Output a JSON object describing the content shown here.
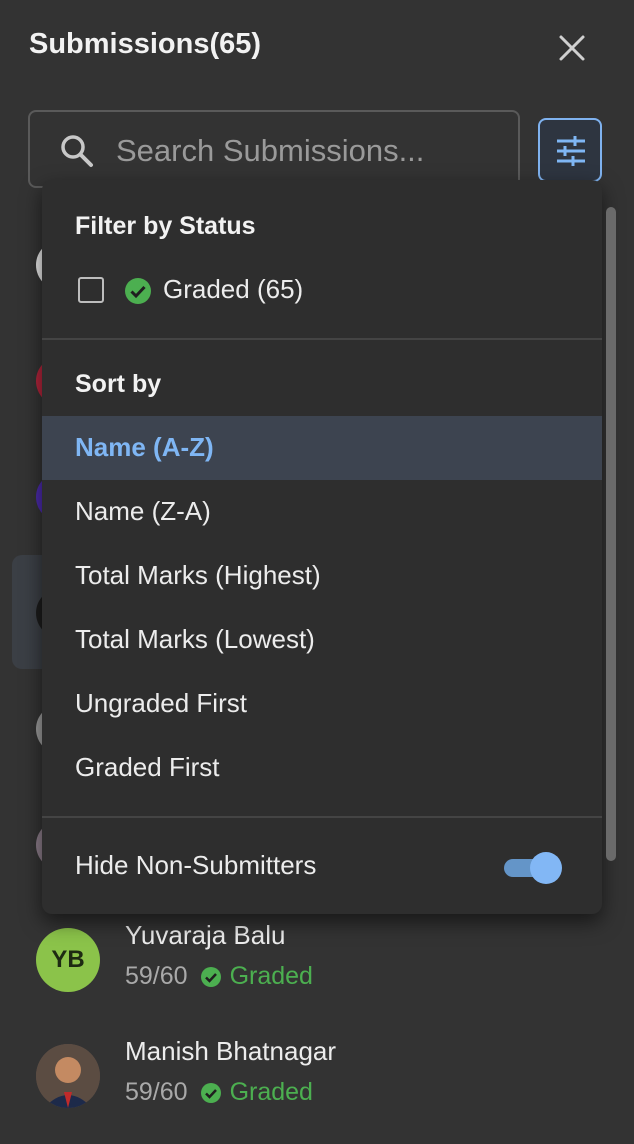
{
  "header": {
    "title": "Submissions(65)"
  },
  "search": {
    "placeholder": "Search Submissions..."
  },
  "filter_menu": {
    "filter_title": "Filter by Status",
    "graded_filter_label": "Graded (65)",
    "sort_title": "Sort by",
    "sort_options": [
      "Name (A-Z)",
      "Name (Z-A)",
      "Total Marks (Highest)",
      "Total Marks (Lowest)",
      "Ungraded First",
      "Graded First"
    ],
    "selected_sort": "Name (A-Z)",
    "hide_non_submitters_label": "Hide Non-Submitters",
    "hide_non_submitters_on": true
  },
  "submissions": [
    {
      "initials": "YB",
      "name": "Yuvaraja Balu",
      "score": "59/60",
      "status": "Graded"
    },
    {
      "initials": "",
      "name": "Manish Bhatnagar",
      "score": "59/60",
      "status": "Graded"
    }
  ],
  "colors": {
    "accent": "#7fb6f4",
    "graded_green": "#4caf50",
    "avatar_yb": "#8bc34a"
  }
}
